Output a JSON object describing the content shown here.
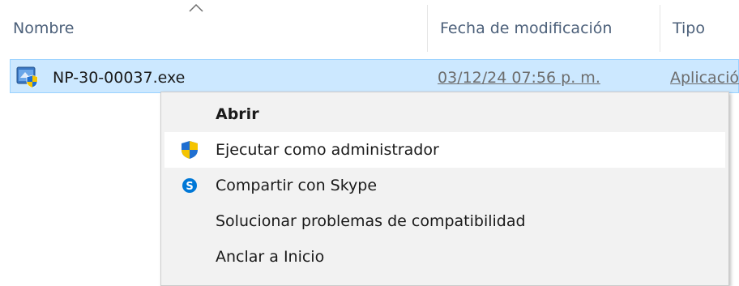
{
  "columns": {
    "name": "Nombre",
    "modified": "Fecha de modificación",
    "type": "Tipo"
  },
  "file": {
    "name": "NP-30-00037.exe",
    "modified": "03/12/24 07:56 p. m.",
    "type": "Aplicación"
  },
  "context_menu": {
    "open": "Abrir",
    "run_as_admin": "Ejecutar como administrador",
    "share_skype": "Compartir con Skype",
    "troubleshoot": "Solucionar problemas de compatibilidad",
    "pin_start": "Anclar a Inicio"
  },
  "icons": {
    "file": "exe-shield-icon",
    "uac": "uac-shield-icon",
    "skype": "skype-icon",
    "sort": "sort-ascending-icon"
  },
  "colors": {
    "selection_bg": "#cce8ff",
    "selection_border": "#99d1ff",
    "header_text": "#4c607a",
    "menu_bg": "#f2f2f2",
    "skype_blue": "#0078d7"
  }
}
